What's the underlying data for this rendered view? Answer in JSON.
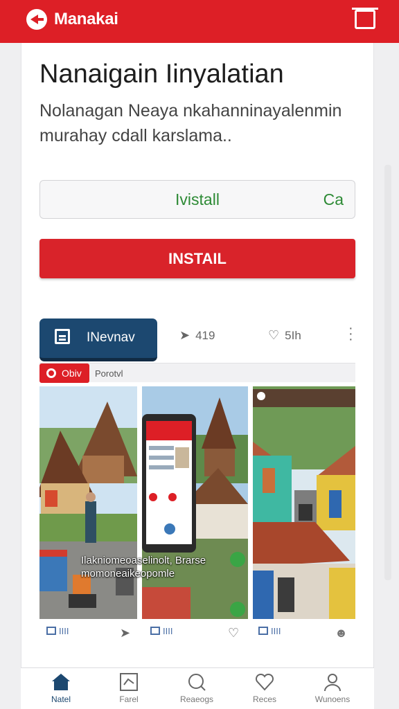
{
  "header": {
    "app_title": "Manakai",
    "logo_icon": "app-logo-icon",
    "right_icon": "screen-icon",
    "brand_color": "#dd1f26"
  },
  "main": {
    "headline": "Nanaigain Iinyalatian",
    "subtitle": "Nolanagan Neaya nkahanninayalenmin murahay cdall karslama..",
    "install_row": {
      "label": "Ivistall",
      "side": "Ca"
    },
    "install_button": "INSTAIL",
    "tabs": {
      "active_label": "INevnav",
      "stat_1": "419",
      "stat_2": "5Ih"
    },
    "filter": {
      "chip": "Obiv",
      "text": "Porotvl"
    },
    "photo_caption": "Ilakniomeoaselinolt, Brarse momoneaikeopomle",
    "photo_actions": [
      "IIII",
      "IIII",
      "IIII"
    ]
  },
  "bottom_nav": [
    {
      "label": "Natel",
      "icon": "home-icon",
      "active": true
    },
    {
      "label": "Farel",
      "icon": "board-icon",
      "active": false
    },
    {
      "label": "Reaeogs",
      "icon": "search-icon",
      "active": false
    },
    {
      "label": "Reces",
      "icon": "heart-icon",
      "active": false
    },
    {
      "label": "Wunoens",
      "icon": "profile-icon",
      "active": false
    }
  ]
}
